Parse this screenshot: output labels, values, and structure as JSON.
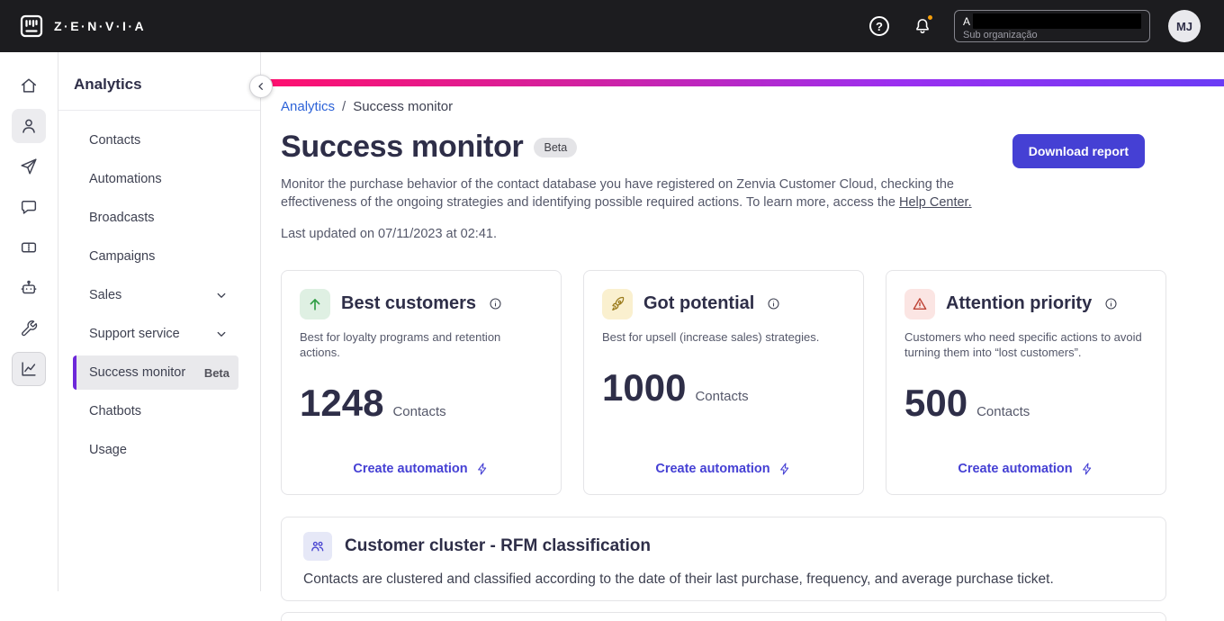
{
  "header": {
    "brand_text": "Z·E·N·V·I·A",
    "org": {
      "visible_letter": "A",
      "sub_label": "Sub organização"
    },
    "avatar_initials": "MJ"
  },
  "sidebar": {
    "title": "Analytics",
    "items": [
      {
        "label": "Contacts"
      },
      {
        "label": "Automations"
      },
      {
        "label": "Broadcasts"
      },
      {
        "label": "Campaigns"
      },
      {
        "label": "Sales",
        "expandable": true
      },
      {
        "label": "Support service",
        "expandable": true
      },
      {
        "label": "Success monitor",
        "badge": "Beta",
        "active": true
      },
      {
        "label": "Chatbots"
      },
      {
        "label": "Usage"
      }
    ]
  },
  "main": {
    "breadcrumb": {
      "parent": "Analytics",
      "separator": "/",
      "current": "Success monitor"
    },
    "title": "Success monitor",
    "beta_badge": "Beta",
    "download_button": "Download report",
    "description_text": "Monitor the purchase behavior of the contact database you have registered on Zenvia Customer Cloud, checking the effectiveness of the ongoing strategies and identifying possible required actions. To learn more, access the ",
    "description_link": "Help Center.",
    "last_updated": "Last updated on 07/11/2023 at 02:41.",
    "cards": [
      {
        "title": "Best customers",
        "description": "Best for loyalty programs and retention actions.",
        "count": "1248",
        "count_label": "Contacts",
        "action_label": "Create automation",
        "icon": "arrow-up-icon"
      },
      {
        "title": "Got potential",
        "description": "Best for upsell (increase sales) strategies.",
        "count": "1000",
        "count_label": "Contacts",
        "action_label": "Create automation",
        "icon": "rocket-icon"
      },
      {
        "title": "Attention priority",
        "description": "Customers who need specific actions to avoid turning them into “lost customers”.",
        "count": "500",
        "count_label": "Contacts",
        "action_label": "Create automation",
        "icon": "warning-icon"
      }
    ],
    "cluster_card": {
      "title": "Customer cluster - RFM classification",
      "description": "Contacts are clustered and classified according to the date of their last purchase, frequency, and average purchase ticket.",
      "icon": "people-icon"
    }
  },
  "icons": [
    "home-icon",
    "user-icon",
    "send-icon",
    "chat-icon",
    "ticket-icon",
    "bot-icon",
    "tools-icon",
    "analytics-icon",
    "question-icon",
    "bell-icon",
    "chevron-left-icon",
    "chevron-down-icon",
    "info-icon",
    "bolt-icon",
    "arrow-up-icon",
    "rocket-icon",
    "warning-icon",
    "people-icon"
  ],
  "colors": {
    "header_bg": "#1c1c1f",
    "accent_indigo": "#4540d4",
    "breadcrumb_blue": "#2d63d8",
    "active_purple": "#6d28d9",
    "gradient_start": "#ff0f6e",
    "gradient_end": "#6b3cf5",
    "success_green": "#2f9e44",
    "rocket_gold": "#9a7b1c",
    "warning_red": "#bf4538",
    "notification_dot": "#f59e0b"
  }
}
